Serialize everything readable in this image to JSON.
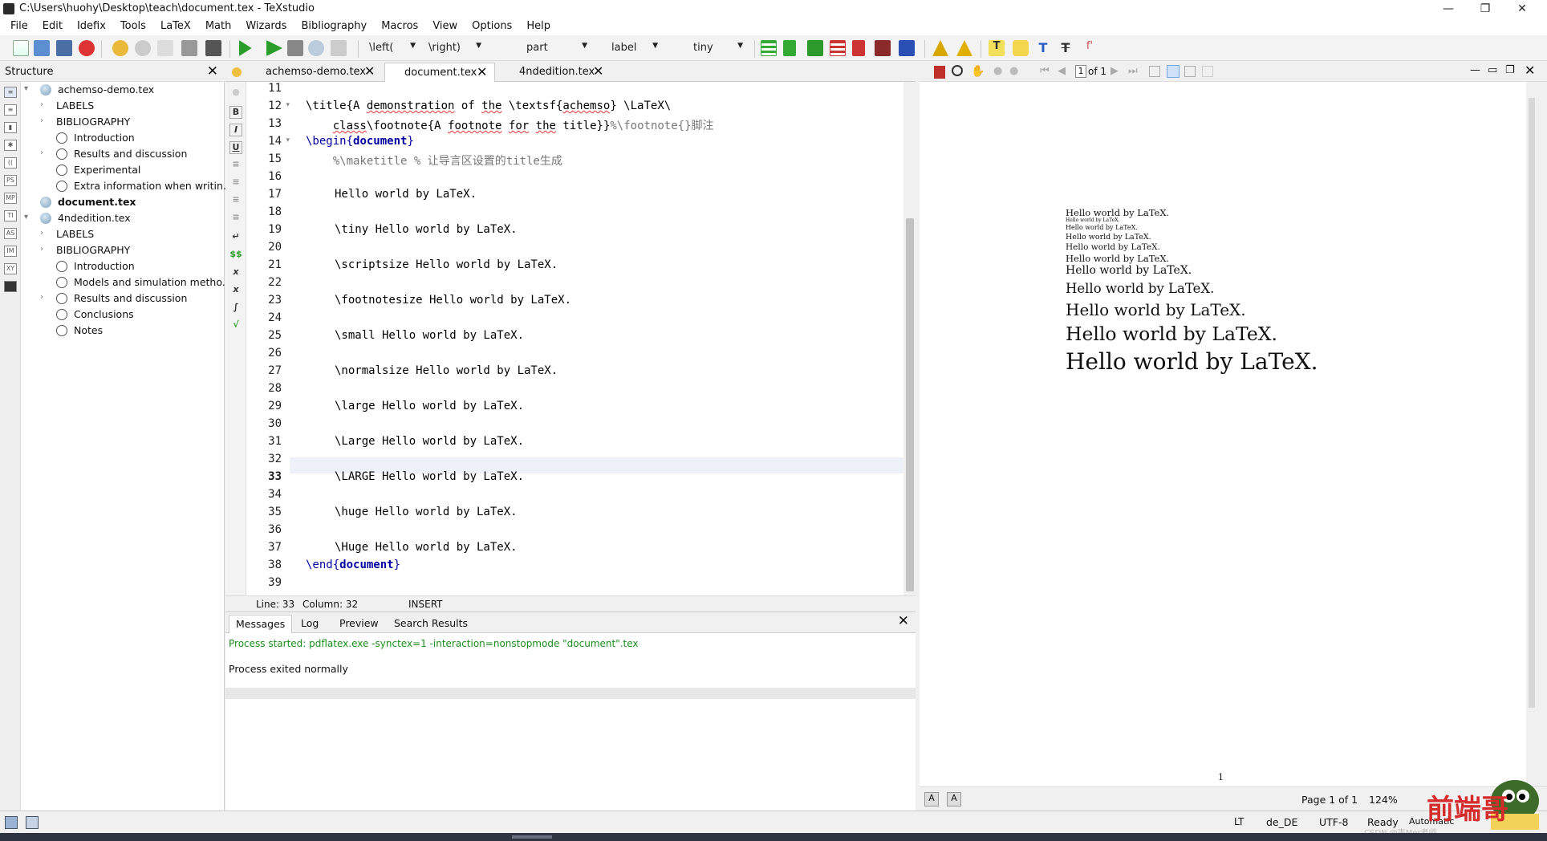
{
  "window": {
    "title": "C:\\Users\\huohy\\Desktop\\teach\\document.tex - TeXstudio",
    "minimize": "—",
    "restore": "❐",
    "close": "✕"
  },
  "menu": [
    "File",
    "Edit",
    "Idefix",
    "Tools",
    "LaTeX",
    "Math",
    "Wizards",
    "Bibliography",
    "Macros",
    "View",
    "Options",
    "Help"
  ],
  "toolbar": {
    "left_combo": "\\left(",
    "right_combo": "\\right)",
    "section_combo": "part",
    "label_combo": "label",
    "size_combo": "tiny"
  },
  "structure": {
    "title": "Structure",
    "close": "✕",
    "items": [
      {
        "label": "achemso-demo.tex",
        "kind": "file",
        "expander": "▾",
        "bold": false
      },
      {
        "label": "LABELS",
        "kind": "group",
        "expander": "›"
      },
      {
        "label": "BIBLIOGRAPHY",
        "kind": "group",
        "expander": "›"
      },
      {
        "label": "Introduction",
        "kind": "section",
        "expander": ""
      },
      {
        "label": "Results and discussion",
        "kind": "section",
        "expander": "›"
      },
      {
        "label": "Experimental",
        "kind": "section",
        "expander": ""
      },
      {
        "label": "Extra information when writin...",
        "kind": "section",
        "expander": ""
      },
      {
        "label": "document.tex",
        "kind": "file",
        "expander": "",
        "bold": true
      },
      {
        "label": "4ndedition.tex",
        "kind": "file",
        "expander": "▾",
        "bold": false
      },
      {
        "label": "LABELS",
        "kind": "group",
        "expander": "›"
      },
      {
        "label": "BIBLIOGRAPHY",
        "kind": "group",
        "expander": "›"
      },
      {
        "label": "Introduction",
        "kind": "section",
        "expander": ""
      },
      {
        "label": "Models and simulation metho...",
        "kind": "section",
        "expander": ""
      },
      {
        "label": "Results and discussion",
        "kind": "section",
        "expander": "›"
      },
      {
        "label": "Conclusions",
        "kind": "section",
        "expander": ""
      },
      {
        "label": "Notes",
        "kind": "section",
        "expander": ""
      }
    ]
  },
  "editor_tabs": [
    {
      "label": "achemso-demo.tex",
      "close": "✕"
    },
    {
      "label": "document.tex",
      "close": "✕"
    },
    {
      "label": "4ndedition.tex",
      "close": "✕"
    }
  ],
  "editor": {
    "line_numbers": [
      "11",
      "12",
      "13",
      "14",
      "15",
      "16",
      "17",
      "18",
      "19",
      "20",
      "21",
      "22",
      "23",
      "24",
      "25",
      "26",
      "27",
      "28",
      "29",
      "30",
      "31",
      "32",
      "33",
      "34",
      "35",
      "36",
      "37",
      "38",
      "39"
    ],
    "current_line": "33",
    "lines": {
      "l12a": "\\title{A ",
      "l12b": "demonstration",
      "l12c": " of ",
      "l12d": "the",
      "l12e": " \\textsf{",
      "l12f": "achemso",
      "l12g": "} \\LaTeX\\",
      "l13a": "    ",
      "l13b": "class",
      "l13c": "\\footnote{A ",
      "l13d": "footnote",
      "l13e": " ",
      "l13f": "for",
      "l13g": " ",
      "l13h": "the",
      "l13i": " title}}",
      "l13j": "%\\footnote{}脚注",
      "l14a": "\\begin{",
      "l14b": "document",
      "l14c": "}",
      "l15": "    %\\maketitle % 让导言区设置的title生成",
      "l17": "Hello world by LaTeX.",
      "l19": "\\tiny Hello world by LaTeX.",
      "l21": "\\scriptsize Hello world by LaTeX.",
      "l23": "\\footnotesize Hello world by LaTeX.",
      "l25": "\\small Hello world by LaTeX.",
      "l27": "\\normalsize Hello world by LaTeX.",
      "l29": "\\large Hello world by LaTeX.",
      "l31": "\\Large Hello world by LaTeX.",
      "l33": "\\LARGE Hello world by LaTeX.",
      "l35": "\\huge Hello world by LaTeX.",
      "l37": "\\Huge Hello world by LaTeX.",
      "l38a": "\\end{",
      "l38b": "document",
      "l38c": "}"
    },
    "gutter_icons": [
      "B",
      "I",
      "U",
      "≡",
      "≡",
      "≡",
      "≡",
      "↵",
      "$$",
      "x",
      "x",
      "∫",
      "√"
    ]
  },
  "editor_status": {
    "line": "Line: 33",
    "column": "Column: 32",
    "mode": "INSERT"
  },
  "messages": {
    "tabs": [
      "Messages",
      "Log",
      "Preview",
      "Search Results"
    ],
    "close": "✕",
    "started": "Process started: pdflatex.exe -synctex=1 -interaction=nonstopmode \"document\".tex",
    "exited": "Process exited normally"
  },
  "pdf": {
    "page_field": "1",
    "page_of": "of 1",
    "lines": [
      "Hello world by LaTeX.",
      "Hello world by LaTeX.",
      "Hello world by LaTeX.",
      "Hello world by LaTeX.",
      "Hello world by LaTeX.",
      "Hello world by LaTeX.",
      "Hello world by LaTeX.",
      "Hello world by LaTeX.",
      "Hello world by LaTeX.",
      "Hello world by LaTeX.",
      "Hello world by LaTeX."
    ],
    "page_number": "1",
    "page_status": "Page 1 of 1",
    "zoom": "124%"
  },
  "statusbar": {
    "lt": "LT",
    "lang": "de_DE",
    "encoding": "UTF-8",
    "ready": "Ready",
    "auto": "Automatic",
    "watermark": "CSDN @韦Mer老师"
  },
  "colors": {
    "accent_green": "#2a9d2a",
    "keyword_blue": "#0000a0",
    "comment_gray": "#777777",
    "message_green": "#1a8f1a",
    "error_squiggle": "#e33333"
  }
}
